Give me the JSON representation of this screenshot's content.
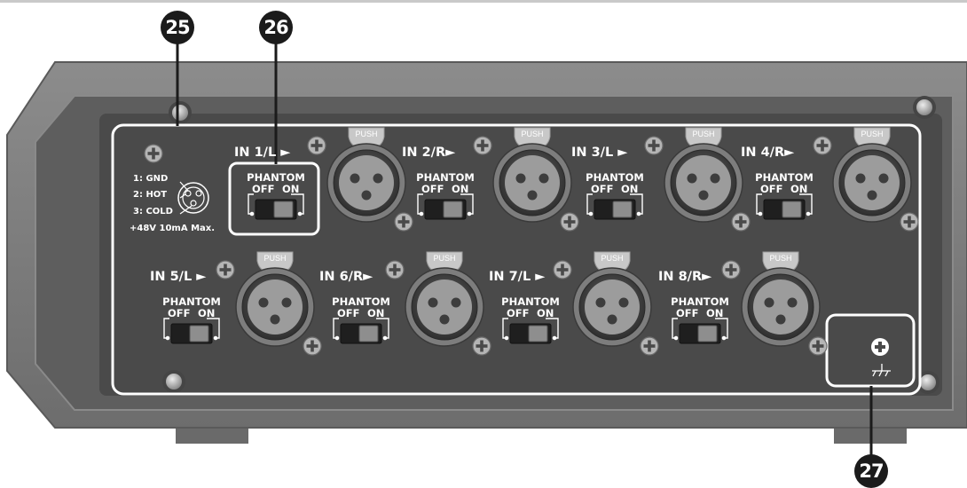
{
  "callouts": {
    "c25": "25",
    "c26": "26",
    "c27": "27"
  },
  "pin_legend": {
    "gnd": "1: GND",
    "hot": "2: HOT",
    "cold": "3: COLD",
    "spec": "+48V 10mA Max."
  },
  "channels": [
    {
      "label": "IN 1/L ►",
      "phantom": "PHANTOM",
      "off": "OFF",
      "on": "ON",
      "push": "PUSH"
    },
    {
      "label": "IN 2/R►",
      "phantom": "PHANTOM",
      "off": "OFF",
      "on": "ON",
      "push": "PUSH"
    },
    {
      "label": "IN 3/L ►",
      "phantom": "PHANTOM",
      "off": "OFF",
      "on": "ON",
      "push": "PUSH"
    },
    {
      "label": "IN 4/R►",
      "phantom": "PHANTOM",
      "off": "OFF",
      "on": "ON",
      "push": "PUSH"
    },
    {
      "label": "IN 5/L ►",
      "phantom": "PHANTOM",
      "off": "OFF",
      "on": "ON",
      "push": "PUSH"
    },
    {
      "label": "IN 6/R►",
      "phantom": "PHANTOM",
      "off": "OFF",
      "on": "ON",
      "push": "PUSH"
    },
    {
      "label": "IN 7/L ►",
      "phantom": "PHANTOM",
      "off": "OFF",
      "on": "ON",
      "push": "PUSH"
    },
    {
      "label": "IN 8/R►",
      "phantom": "PHANTOM",
      "off": "OFF",
      "on": "ON",
      "push": "PUSH"
    }
  ],
  "colors": {
    "chassis": "#7a7a7a",
    "panel": "#4a4a4a",
    "highlight": "#ffffff",
    "callout": "#1b1b1b"
  }
}
